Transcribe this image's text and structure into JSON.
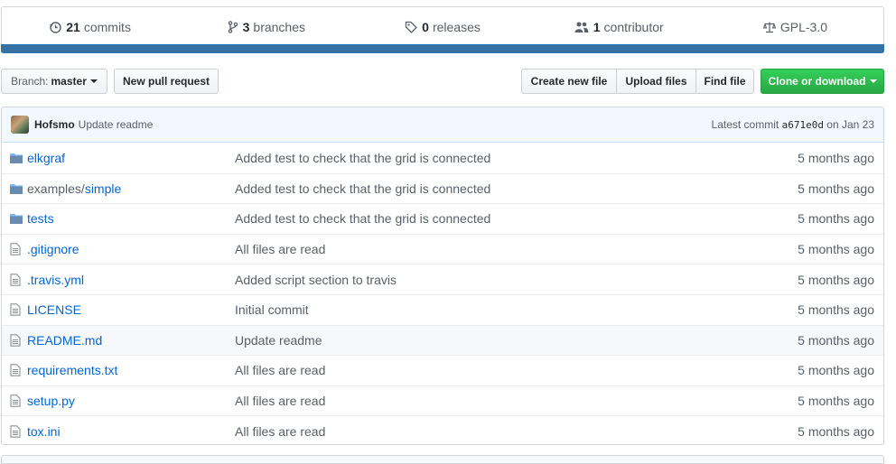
{
  "summary": {
    "commits": {
      "num": "21",
      "label": "commits",
      "icon": "history-icon"
    },
    "branches": {
      "num": "3",
      "label": "branches",
      "icon": "git-branch-icon"
    },
    "releases": {
      "num": "0",
      "label": "releases",
      "icon": "tag-icon"
    },
    "contributors": {
      "num": "1",
      "label": "contributor",
      "icon": "people-icon"
    },
    "license": {
      "label": "GPL-3.0",
      "icon": "law-icon"
    },
    "language_color": "#3572a5"
  },
  "toolbar": {
    "branch_label": "Branch:",
    "branch_value": "master",
    "new_pr": "New pull request",
    "create_file": "Create new file",
    "upload_files": "Upload files",
    "find_file": "Find file",
    "clone": "Clone or download"
  },
  "commit": {
    "author": "Hofsmo",
    "message": "Update readme",
    "latest_prefix": "Latest commit",
    "sha": "a671e0d",
    "on_date": "on Jan 23"
  },
  "files": [
    {
      "type": "dir",
      "prefix": "",
      "name": "elkgraf",
      "message": "Added test to check that the grid is connected",
      "age": "5 months ago"
    },
    {
      "type": "dir",
      "prefix": "examples/",
      "name": "simple",
      "message": "Added test to check that the grid is connected",
      "age": "5 months ago"
    },
    {
      "type": "dir",
      "prefix": "",
      "name": "tests",
      "message": "Added test to check that the grid is connected",
      "age": "5 months ago"
    },
    {
      "type": "file",
      "prefix": "",
      "name": ".gitignore",
      "message": "All files are read",
      "age": "5 months ago"
    },
    {
      "type": "file",
      "prefix": "",
      "name": ".travis.yml",
      "message": "Added script section to travis",
      "age": "5 months ago"
    },
    {
      "type": "file",
      "prefix": "",
      "name": "LICENSE",
      "message": "Initial commit",
      "age": "5 months ago"
    },
    {
      "type": "file",
      "prefix": "",
      "name": "README.md",
      "message": "Update readme",
      "age": "5 months ago"
    },
    {
      "type": "file",
      "prefix": "",
      "name": "requirements.txt",
      "message": "All files are read",
      "age": "5 months ago"
    },
    {
      "type": "file",
      "prefix": "",
      "name": "setup.py",
      "message": "All files are read",
      "age": "5 months ago"
    },
    {
      "type": "file",
      "prefix": "",
      "name": "tox.ini",
      "message": "All files are read",
      "age": "5 months ago"
    }
  ]
}
